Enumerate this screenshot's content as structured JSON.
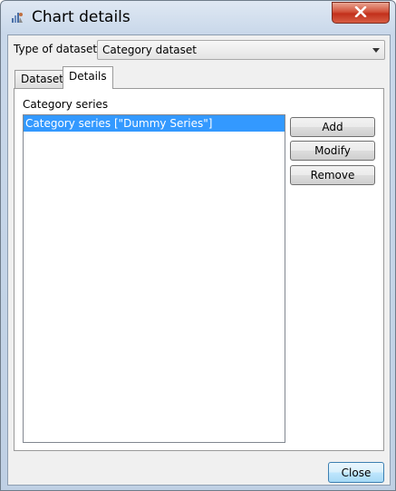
{
  "window": {
    "title": "Chart details",
    "icon": "chart-app-icon",
    "close_glyph": "✕"
  },
  "dataset_type": {
    "label": "Type of dataset",
    "selected": "Category dataset"
  },
  "tabs": [
    {
      "label": "Dataset",
      "active": false
    },
    {
      "label": "Details",
      "active": true
    }
  ],
  "details": {
    "series_label": "Category series",
    "series_items": [
      "Category series [\"Dummy Series\"]"
    ],
    "buttons": {
      "add": "Add",
      "modify": "Modify",
      "remove": "Remove"
    }
  },
  "footer": {
    "close_label": "Close"
  },
  "colors": {
    "selection": "#3399ff",
    "close_button": "#c2301b"
  }
}
